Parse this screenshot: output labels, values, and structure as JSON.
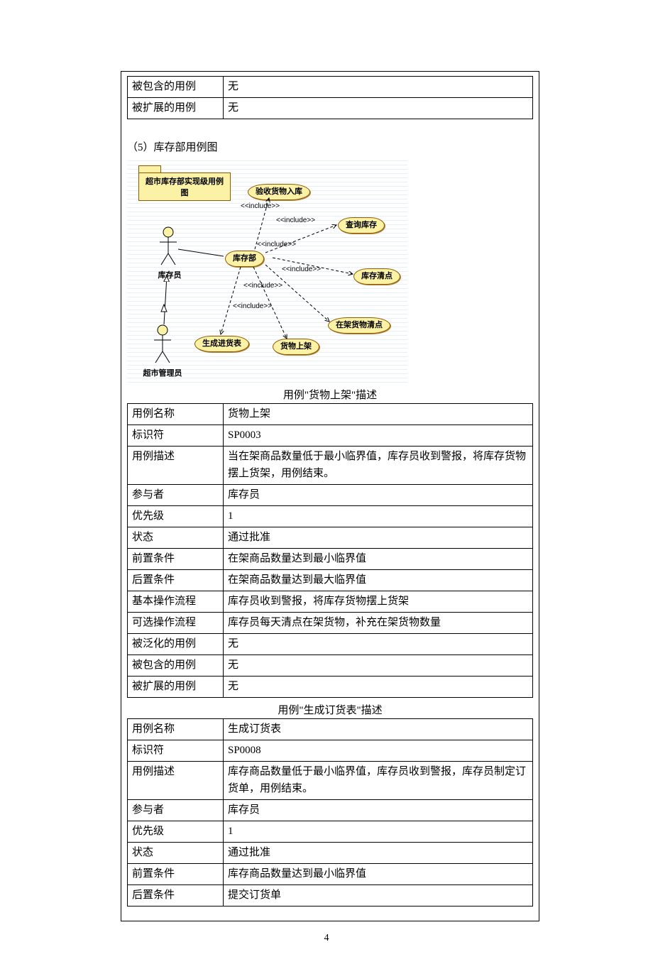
{
  "page_number": "4",
  "top_table": {
    "rows": [
      {
        "label": "被包含的用例",
        "value": "无"
      },
      {
        "label": "被扩展的用例",
        "value": "无"
      }
    ]
  },
  "section_title": "（5）库存部用例图",
  "diagram": {
    "title": "超市库存部实现级用例图",
    "actors": {
      "warehouse_clerk": "库存员",
      "supermarket_admin": "超市管理员"
    },
    "usecases": {
      "check_goods_in": "验收货物入库",
      "query_inventory": "查询库存",
      "warehouse_dept": "库存部",
      "inventory_check": "库存清点",
      "on_shelf_check": "在架货物清点",
      "generate_purchase": "生成进货表",
      "goods_on_shelf": "货物上架"
    },
    "include_label": "<<include>>"
  },
  "caption_table1": "用例\"货物上架\"描述",
  "table1": {
    "rows": [
      {
        "label": "用例名称",
        "value": "货物上架"
      },
      {
        "label": "标识符",
        "value": "SP0003"
      },
      {
        "label": "用例描述",
        "value": "当在架商品数量低于最小临界值，库存员收到警报，将库存货物摆上货架，用例结束。"
      },
      {
        "label": "参与者",
        "value": "库存员"
      },
      {
        "label": "优先级",
        "value": "1"
      },
      {
        "label": "状态",
        "value": "通过批准"
      },
      {
        "label": "前置条件",
        "value": "在架商品数量达到最小临界值"
      },
      {
        "label": "后置条件",
        "value": "在架商品数量达到最大临界值"
      },
      {
        "label": "基本操作流程",
        "value": "库存员收到警报，将库存货物摆上货架"
      },
      {
        "label": "可选操作流程",
        "value": "库存员每天清点在架货物，补充在架货物数量"
      },
      {
        "label": "被泛化的用例",
        "value": "无"
      },
      {
        "label": "被包含的用例",
        "value": "无"
      },
      {
        "label": "被扩展的用例",
        "value": "无"
      }
    ]
  },
  "caption_table2": "用例\"生成订货表\"描述",
  "table2": {
    "rows": [
      {
        "label": "用例名称",
        "value": "生成订货表"
      },
      {
        "label": "标识符",
        "value": "SP0008"
      },
      {
        "label": "用例描述",
        "value": "库存商品数量低于最小临界值，库存员收到警报，库存员制定订货单，用例结束。"
      },
      {
        "label": "参与者",
        "value": "库存员"
      },
      {
        "label": "优先级",
        "value": "1"
      },
      {
        "label": "状态",
        "value": "通过批准"
      },
      {
        "label": "前置条件",
        "value": "库存商品数量达到最小临界值"
      },
      {
        "label": "后置条件",
        "value": "提交订货单"
      }
    ]
  }
}
